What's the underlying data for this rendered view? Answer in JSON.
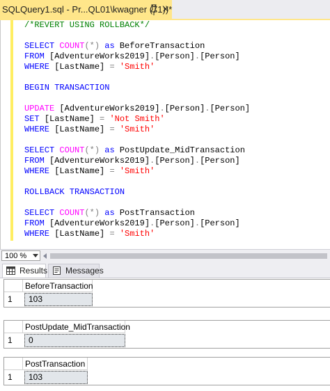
{
  "tab": {
    "title": "SQLQuery1.sql - Pr...QL01\\kwagner (71))*",
    "close_glyph": "×"
  },
  "editor": {
    "lines": [
      [
        {
          "t": "/*REVERT USING ROLLBACK*/",
          "c": "cm"
        }
      ],
      [],
      [
        {
          "t": "SELECT ",
          "c": "kw"
        },
        {
          "t": "COUNT",
          "c": "fn"
        },
        {
          "t": "(*) ",
          "c": "op"
        },
        {
          "t": "as ",
          "c": "kw"
        },
        {
          "t": "BeforeTransaction",
          "c": ""
        }
      ],
      [
        {
          "t": "FROM ",
          "c": "kw"
        },
        {
          "t": "[AdventureWorks2019]",
          "c": ""
        },
        {
          "t": ".",
          "c": "op"
        },
        {
          "t": "[Person]",
          "c": ""
        },
        {
          "t": ".",
          "c": "op"
        },
        {
          "t": "[Person]",
          "c": ""
        }
      ],
      [
        {
          "t": "WHERE ",
          "c": "kw"
        },
        {
          "t": "[LastName] ",
          "c": ""
        },
        {
          "t": "= ",
          "c": "op"
        },
        {
          "t": "'Smith'",
          "c": "str"
        }
      ],
      [],
      [
        {
          "t": "BEGIN TRANSACTION",
          "c": "kw"
        }
      ],
      [],
      [
        {
          "t": "UPDATE ",
          "c": "fn"
        },
        {
          "t": "[AdventureWorks2019]",
          "c": ""
        },
        {
          "t": ".",
          "c": "op"
        },
        {
          "t": "[Person]",
          "c": ""
        },
        {
          "t": ".",
          "c": "op"
        },
        {
          "t": "[Person]",
          "c": ""
        }
      ],
      [
        {
          "t": "SET ",
          "c": "kw"
        },
        {
          "t": "[LastName] ",
          "c": ""
        },
        {
          "t": "= ",
          "c": "op"
        },
        {
          "t": "'Not Smith'",
          "c": "str"
        }
      ],
      [
        {
          "t": "WHERE ",
          "c": "kw"
        },
        {
          "t": "[LastName] ",
          "c": ""
        },
        {
          "t": "= ",
          "c": "op"
        },
        {
          "t": "'Smith'",
          "c": "str"
        }
      ],
      [],
      [
        {
          "t": "SELECT ",
          "c": "kw"
        },
        {
          "t": "COUNT",
          "c": "fn"
        },
        {
          "t": "(*) ",
          "c": "op"
        },
        {
          "t": "as ",
          "c": "kw"
        },
        {
          "t": "PostUpdate_MidTransaction",
          "c": ""
        }
      ],
      [
        {
          "t": "FROM ",
          "c": "kw"
        },
        {
          "t": "[AdventureWorks2019]",
          "c": ""
        },
        {
          "t": ".",
          "c": "op"
        },
        {
          "t": "[Person]",
          "c": ""
        },
        {
          "t": ".",
          "c": "op"
        },
        {
          "t": "[Person]",
          "c": ""
        }
      ],
      [
        {
          "t": "WHERE ",
          "c": "kw"
        },
        {
          "t": "[LastName] ",
          "c": ""
        },
        {
          "t": "= ",
          "c": "op"
        },
        {
          "t": "'Smith'",
          "c": "str"
        }
      ],
      [],
      [
        {
          "t": "ROLLBACK TRANSACTION",
          "c": "kw"
        }
      ],
      [],
      [
        {
          "t": "SELECT ",
          "c": "kw"
        },
        {
          "t": "COUNT",
          "c": "fn"
        },
        {
          "t": "(*) ",
          "c": "op"
        },
        {
          "t": "as ",
          "c": "kw"
        },
        {
          "t": "PostTransaction",
          "c": ""
        }
      ],
      [
        {
          "t": "FROM ",
          "c": "kw"
        },
        {
          "t": "[AdventureWorks2019]",
          "c": ""
        },
        {
          "t": ".",
          "c": "op"
        },
        {
          "t": "[Person]",
          "c": ""
        },
        {
          "t": ".",
          "c": "op"
        },
        {
          "t": "[Person]",
          "c": ""
        }
      ],
      [
        {
          "t": "WHERE ",
          "c": "kw"
        },
        {
          "t": "[LastName] ",
          "c": ""
        },
        {
          "t": "= ",
          "c": "op"
        },
        {
          "t": "'Smith'",
          "c": "str"
        }
      ]
    ]
  },
  "zoom": {
    "value": "100 %"
  },
  "results_tabs": {
    "results_label": "Results",
    "messages_label": "Messages"
  },
  "grids": [
    {
      "column": "BeforeTransaction",
      "row_number": "1",
      "value": "103"
    },
    {
      "column": "PostUpdate_MidTransaction",
      "row_number": "1",
      "value": "0"
    },
    {
      "column": "PostTransaction",
      "row_number": "1",
      "value": "103"
    }
  ],
  "colors": {
    "active_tab": "#ffe68a",
    "keyword": "#0000ff",
    "function": "#ff00ff",
    "string": "#ff0000",
    "comment": "#008000",
    "operator": "#808080"
  }
}
